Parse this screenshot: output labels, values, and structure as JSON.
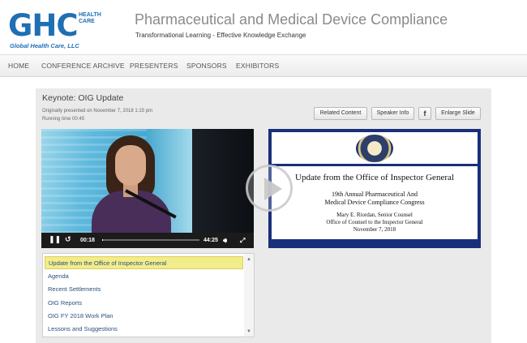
{
  "header": {
    "logo_text": "GHC",
    "logo_side_line1": "HEALTH",
    "logo_side_line2": "CARE",
    "logo_company": "Global Health Care, LLC",
    "site_title": "Pharmaceutical and Medical Device Compliance",
    "tagline": "Transformational Learning - Effective Knowledge Exchange"
  },
  "nav": {
    "items": [
      "HOME",
      "CONFERENCE ARCHIVE",
      "PRESENTERS",
      "SPONSORS",
      "EXHIBITORS"
    ]
  },
  "presentation": {
    "title": "Keynote: OIG Update",
    "presented": "Originally presented on November 7, 2018 1:15 pm",
    "running": "Running time 00:45"
  },
  "buttons": {
    "related": "Related Content",
    "speaker": "Speaker Info",
    "facebook": "f",
    "enlarge": "Enlarge Slide"
  },
  "player": {
    "current_time": "00:18",
    "duration": "44:25",
    "progress_fraction": 0.01
  },
  "slide": {
    "title": "Update from the Office of Inspector General",
    "line1": "19th Annual Pharmaceutical And",
    "line2": "Medical Device Compliance Congress",
    "line3": "Mary E. Riordan, Senior Counsel",
    "line4": "Office of Counsel to the Inspector General",
    "line5": "November 7, 2018"
  },
  "chapters": [
    "Update from the Office of Inspector General",
    "Agenda",
    "Recent Settlements",
    "OIG Reports",
    "OIG FY 2018 Work Plan",
    "Lessons and Suggestions"
  ],
  "colors": {
    "brand": "#1f6fb2",
    "active_chapter": "#f3ec8a",
    "slide_frame": "#1a2f7a"
  }
}
